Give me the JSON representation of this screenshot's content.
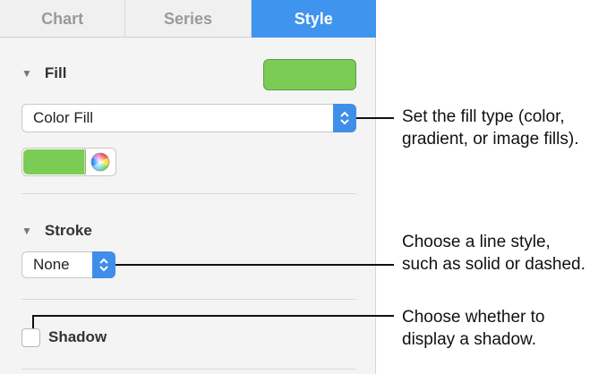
{
  "tabs": [
    {
      "label": "Chart",
      "active": false
    },
    {
      "label": "Series",
      "active": false
    },
    {
      "label": "Style",
      "active": true
    }
  ],
  "fill": {
    "header": "Fill",
    "swatch_color": "#7bcc55",
    "type_popup_value": "Color Fill",
    "well_color": "#7bcc55"
  },
  "stroke": {
    "header": "Stroke",
    "style_popup_value": "None"
  },
  "shadow": {
    "label": "Shadow",
    "checked": false
  },
  "callouts": [
    {
      "line1": "Set the fill type (color,",
      "line2": "gradient, or image fills)."
    },
    {
      "line1": "Choose a line style,",
      "line2": "such as solid or dashed."
    },
    {
      "line1": "Choose whether to",
      "line2": "display a shadow."
    }
  ],
  "colors": {
    "accent": "#3f95ee",
    "green": "#7bcc55"
  }
}
